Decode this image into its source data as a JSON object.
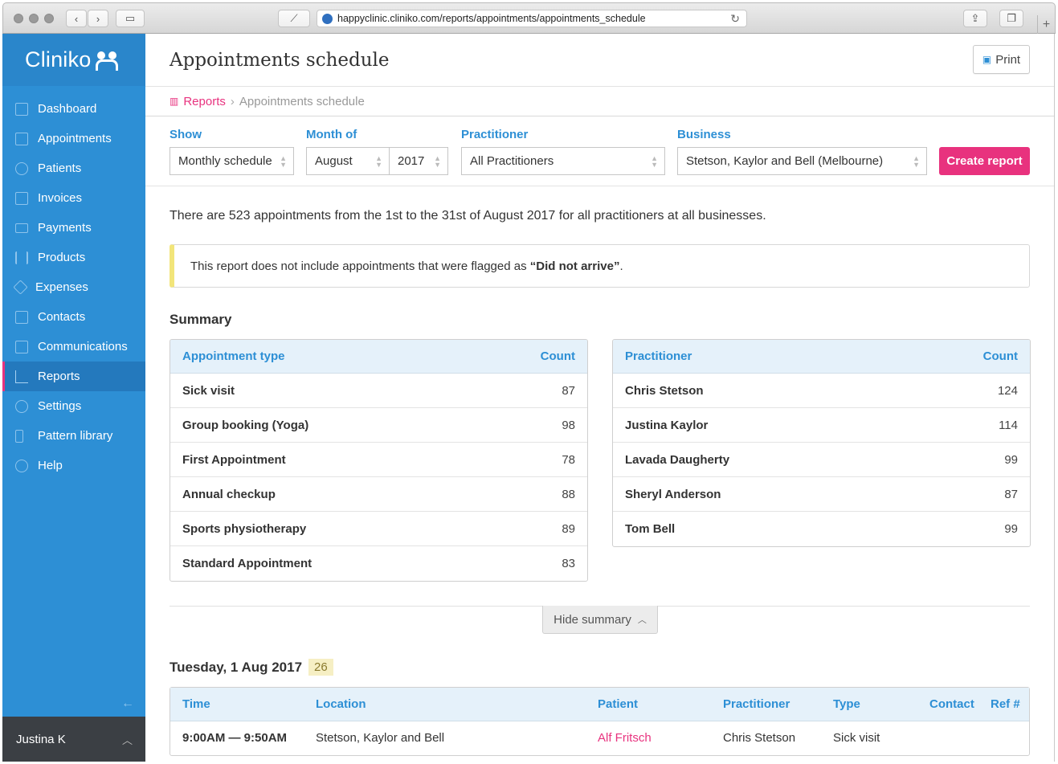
{
  "browser": {
    "url": "happyclinic.cliniko.com/reports/appointments/appointments_schedule"
  },
  "sidebar": {
    "brand": "Cliniko",
    "items": [
      {
        "label": "Dashboard",
        "icon": "dashboard-icon"
      },
      {
        "label": "Appointments",
        "icon": "calendar-icon"
      },
      {
        "label": "Patients",
        "icon": "patients-icon"
      },
      {
        "label": "Invoices",
        "icon": "invoice-icon"
      },
      {
        "label": "Payments",
        "icon": "card-icon"
      },
      {
        "label": "Products",
        "icon": "barcode-icon"
      },
      {
        "label": "Expenses",
        "icon": "tag-icon"
      },
      {
        "label": "Contacts",
        "icon": "contacts-icon"
      },
      {
        "label": "Communications",
        "icon": "chat-icon"
      },
      {
        "label": "Reports",
        "icon": "chart-icon",
        "active": true
      },
      {
        "label": "Settings",
        "icon": "gear-icon"
      },
      {
        "label": "Pattern library",
        "icon": "pattern-icon"
      },
      {
        "label": "Help",
        "icon": "lifebuoy-icon"
      }
    ],
    "user": "Justina K"
  },
  "header": {
    "title": "Appointments schedule",
    "print_label": "Print"
  },
  "breadcrumb": {
    "parent": "Reports",
    "current": "Appointments schedule"
  },
  "filters": {
    "show_label": "Show",
    "show_value": "Monthly schedule",
    "month_label": "Month of",
    "month_value": "August",
    "year_value": "2017",
    "practitioner_label": "Practitioner",
    "practitioner_value": "All Practitioners",
    "business_label": "Business",
    "business_value": "Stetson, Kaylor and Bell (Melbourne)",
    "create_label": "Create report"
  },
  "intro": "There are 523 appointments from the 1st to the 31st of August 2017 for all practitioners at all businesses.",
  "notice": {
    "text": "This report does not include appointments that were flagged as ",
    "flag": "“Did not arrive”",
    "end": "."
  },
  "summary": {
    "title": "Summary",
    "types": {
      "header_name": "Appointment type",
      "header_count": "Count",
      "rows": [
        {
          "name": "Sick visit",
          "count": "87"
        },
        {
          "name": "Group booking (Yoga)",
          "count": "98"
        },
        {
          "name": "First Appointment",
          "count": "78"
        },
        {
          "name": "Annual checkup",
          "count": "88"
        },
        {
          "name": "Sports physiotherapy",
          "count": "89"
        },
        {
          "name": "Standard Appointment",
          "count": "83"
        }
      ]
    },
    "practitioners": {
      "header_name": "Practitioner",
      "header_count": "Count",
      "rows": [
        {
          "name": "Chris Stetson",
          "count": "124"
        },
        {
          "name": "Justina Kaylor",
          "count": "114"
        },
        {
          "name": "Lavada Daugherty",
          "count": "99"
        },
        {
          "name": "Sheryl Anderson",
          "count": "87"
        },
        {
          "name": "Tom Bell",
          "count": "99"
        }
      ]
    },
    "hide_label": "Hide summary"
  },
  "schedule": {
    "day": "Tuesday, 1 Aug 2017",
    "day_count": "26",
    "columns": {
      "time": "Time",
      "location": "Location",
      "patient": "Patient",
      "practitioner": "Practitioner",
      "type": "Type",
      "contact": "Contact",
      "ref": "Ref #"
    },
    "rows": [
      {
        "time": "9:00AM — 9:50AM",
        "location": "Stetson, Kaylor and Bell",
        "patient": "Alf Fritsch",
        "practitioner": "Chris Stetson",
        "type": "Sick visit",
        "contact": "",
        "ref": ""
      }
    ]
  }
}
